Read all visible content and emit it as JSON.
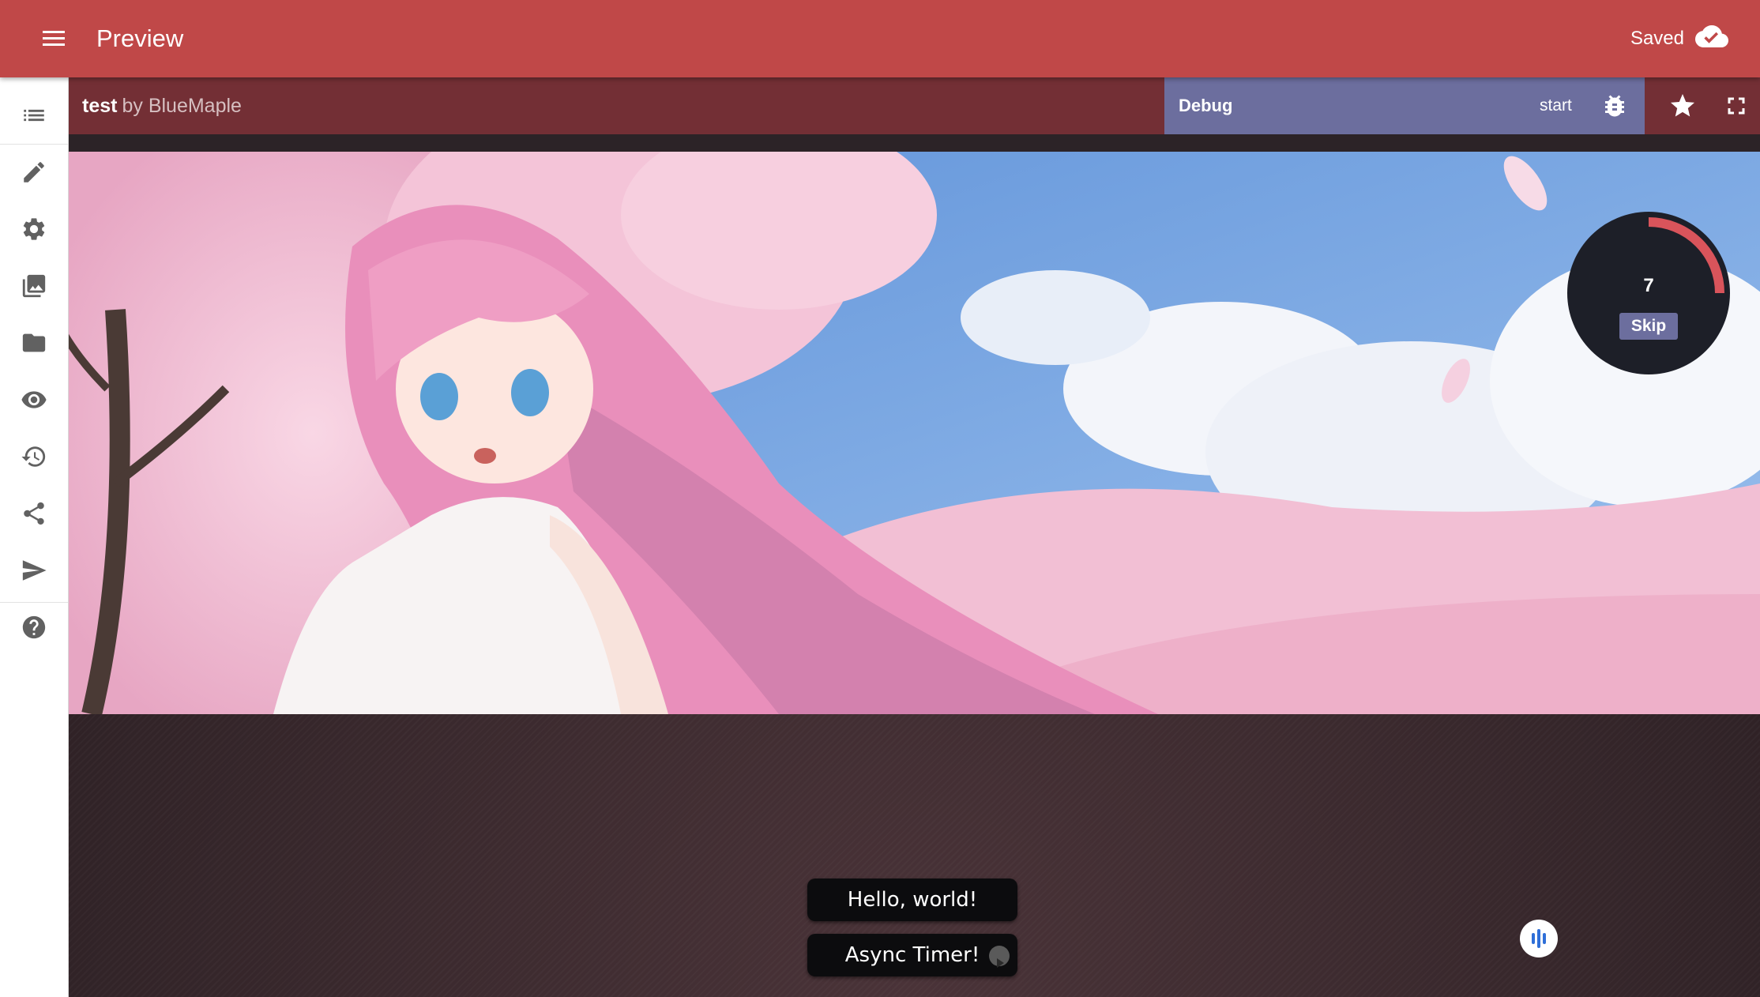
{
  "topbar": {
    "title": "Preview",
    "saved_label": "Saved"
  },
  "sidebar": {
    "items": [
      {
        "icon": "list-icon"
      },
      {
        "icon": "pencil-icon"
      },
      {
        "icon": "gear-icon"
      },
      {
        "icon": "images-icon"
      },
      {
        "icon": "folder-icon"
      },
      {
        "icon": "eye-icon"
      },
      {
        "icon": "history-icon"
      },
      {
        "icon": "share-icon"
      },
      {
        "icon": "send-icon"
      },
      {
        "icon": "help-icon"
      }
    ]
  },
  "project": {
    "name": "test",
    "author": "by BlueMaple"
  },
  "debug": {
    "label": "Debug",
    "start_label": "start"
  },
  "timer": {
    "count": "7",
    "skip_label": "Skip",
    "progress": 0.25
  },
  "choices": [
    {
      "label": "Hello, world!"
    },
    {
      "label": "Async Timer!"
    }
  ],
  "colors": {
    "topbar": "#c04848",
    "project_bar": "#732f35",
    "debug_bar": "#6c6e9e"
  }
}
